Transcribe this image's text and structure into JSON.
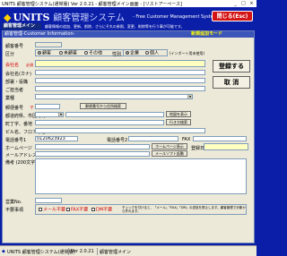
{
  "window": {
    "title": "UNITS 顧客管理システム(通常版) Ver 2.0.21 - 顧客管理メイン画面 - [リストアーペース]",
    "minimize": "_",
    "maximize": "□",
    "close": "×"
  },
  "header": {
    "logo": "UNITS",
    "logo_jp": "顧客管理システム",
    "subtitle": "- Free Customer Management System -",
    "close_button": "閉じる(Esc)"
  },
  "nav": {
    "title": "顧客管理メイン",
    "description": "顧客情報の追加、更新、削除、さらにそれの参照、変更、削除等を行う事が可能です。"
  },
  "panel": {
    "header": "顧客管理-Customer Information-",
    "mode": "新規追加モード"
  },
  "form": {
    "customer_no_label": "顧客番号",
    "category_label": "区分",
    "category_options": [
      "顧客",
      "未顧客",
      "その他"
    ],
    "gender_label": "性別",
    "gender_options": [
      "企業",
      "個人"
    ],
    "entity_note": "(インポート用未使用)",
    "company_label": "会社名",
    "required": "必須",
    "company_kana_label": "会社名(カナ)",
    "dept_label": "部署・役職",
    "contact_label": "ご担当者",
    "industry_label": "業種",
    "postal_label": "郵便番号",
    "postal_mark": "〒",
    "postal_search_button": "郵便番号から住所検索",
    "pref_label": "都道府県、市区町村",
    "map_button": "地図を表示",
    "town_label": "町丁字、番地",
    "route_button": "行き方検索",
    "building_label": "ビル名、フロアなど",
    "phone_label": "電話番号1",
    "phone_value": "0120623923",
    "phone2_label": "電話番号2",
    "fax_label": "FAX",
    "homepage_label": "ホームページ",
    "homepage_button": "ホームページ表示",
    "email_label": "メールアドレス",
    "email_button": "メールソフト起動",
    "remarks_label": "備考 (200文字)",
    "register_date_label": "登録日",
    "sales_label": "営業No.",
    "mail_label": "不要事項",
    "mail_options": [
      "メール不要",
      "FAX不要",
      "DM不要"
    ],
    "mail_note": "チェックを付けると、「メール」「FAX」「DM」の送信を禁止します。顧客管理で対象から外れます。"
  },
  "buttons": {
    "register": "登録する",
    "cancel": "取 消"
  },
  "statusbar": {
    "app": "UNITS 顧客管理システム(通常版)",
    "version": "Ver 2.0.21",
    "screen": "顧客管理メイン"
  }
}
